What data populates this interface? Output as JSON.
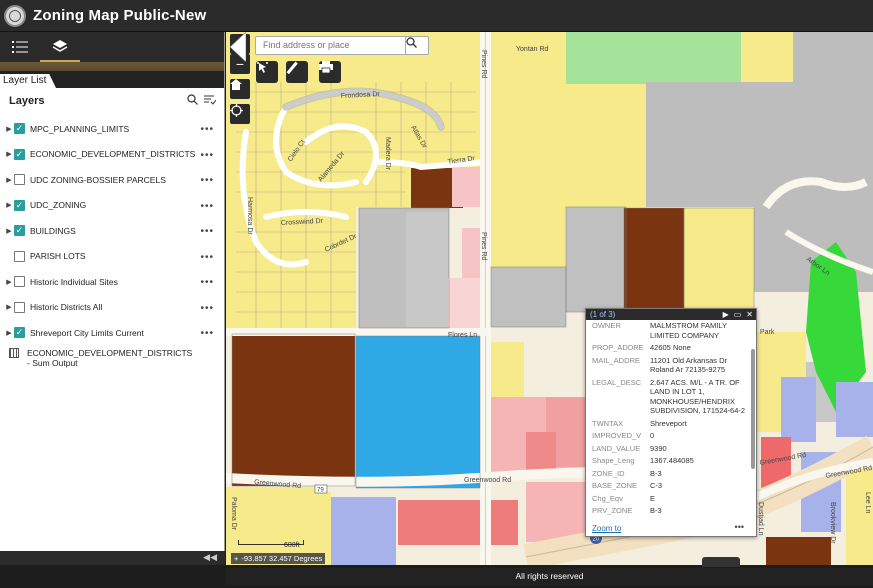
{
  "app": {
    "title": "Zoning Map Public-New"
  },
  "toolbar": {
    "layerlist_icon": "list-icon",
    "layers_icon": "stack-icon"
  },
  "panel": {
    "tab_label": "Layer List",
    "header": "Layers",
    "layers": [
      {
        "label": "MPC_PLANNING_LIMITS",
        "checked": true,
        "expandable": true
      },
      {
        "label": "ECONOMIC_DEVELOPMENT_DISTRICTS",
        "checked": true,
        "expandable": true
      },
      {
        "label": "UDC ZONING-BOSSIER PARCELS",
        "checked": false,
        "expandable": true
      },
      {
        "label": "UDC_ZONING",
        "checked": true,
        "expandable": true
      },
      {
        "label": "BUILDINGS",
        "checked": true,
        "expandable": true
      },
      {
        "label": "PARISH LOTS",
        "checked": false,
        "expandable": false
      },
      {
        "label": "Historic Individual Sites",
        "checked": false,
        "expandable": true
      },
      {
        "label": "Historic Districts All",
        "checked": false,
        "expandable": true
      },
      {
        "label": "Shreveport City Limits Current",
        "checked": true,
        "expandable": true
      }
    ],
    "table_layer": {
      "label": "ECONOMIC_DEVELOPMENT_DISTRICTS - Sum Output"
    },
    "more_glyph": "•••"
  },
  "search": {
    "placeholder": "Find address or place"
  },
  "map_labels": {
    "roads": [
      "Yontan Rd",
      "Pines Rd",
      "Frondosa Dr",
      "Tierra Dr",
      "Madera Dr",
      "Alameda Dr",
      "Cielo Ct",
      "Crosswind Dr",
      "Cobrdet Dr",
      "Flores Ln",
      "Greenwood Rd",
      "Park",
      "Greenwood Rd",
      "Greenwood Rd",
      "Arbor Ln",
      "Pines Rd",
      "Harmosa Dr",
      "Atlas Dr",
      "Greenwood Rd",
      "Paloma Dr",
      "Dustjad Ln",
      "Brookview Dr",
      "Lee Ln"
    ],
    "shields": [
      "79",
      "20"
    ]
  },
  "popup": {
    "counter": "(1 of 3)",
    "fields": [
      {
        "k": "OWNER",
        "v": "MALMSTROM FAMILY LIMITED COMPANY"
      },
      {
        "k": "PROP_ADDRE",
        "v": "42605 None"
      },
      {
        "k": "MAIL_ADDRE",
        "v": "11201 Old Arkansas Dr Roland Ar 72135-9275"
      },
      {
        "k": "LEGAL_DESC",
        "v": "2.647 ACS. M/L - A TR. OF LAND IN LOT 1, MONKHOUSE/HENDRIX SUBDIVISION, 171524-64-2"
      },
      {
        "k": "TWNTAX",
        "v": "Shreveport"
      },
      {
        "k": "IMPROVED_V",
        "v": "0"
      },
      {
        "k": "LAND_VALUE",
        "v": "9390"
      },
      {
        "k": "Shape_Leng",
        "v": "1367.484085"
      },
      {
        "k": "ZONE_ID",
        "v": "B-3"
      },
      {
        "k": "BASE_ZONE",
        "v": "C-3"
      },
      {
        "k": "Chg_Eqv",
        "v": "E"
      },
      {
        "k": "PRV_ZONE",
        "v": "B-3"
      }
    ],
    "zoom_link": "Zoom to"
  },
  "scale": {
    "label": "600ft"
  },
  "coords": {
    "value": "-93.857 32.457 Degrees"
  },
  "footer": {
    "text": "All rights reserved"
  },
  "colors": {
    "accent": "#2a9d9d",
    "header_bg": "#2b2b2b"
  }
}
